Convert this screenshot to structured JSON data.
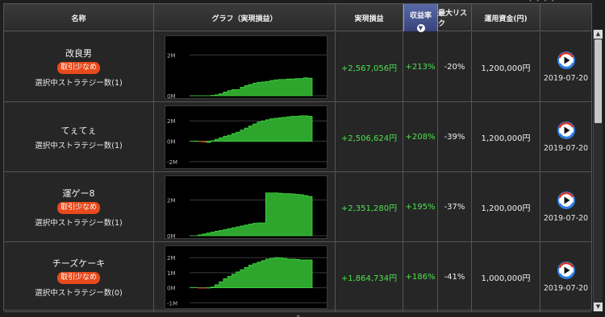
{
  "header": {
    "name": "名称",
    "graph": "グラフ（実現損益）",
    "profit": "実現損益",
    "return_rate": "収益率",
    "max_risk": "最大リスク",
    "capital": "運用資金(円)",
    "sort_icon": "chevron-down-icon"
  },
  "top_right_text": "・ ・ ・ ・",
  "bottom_indicator": "⌄",
  "colors": {
    "profit_green": "#4ee24e",
    "chart_green": "#2ea62e",
    "loss_red": "#e02020",
    "badge_orange": "#e84a1c",
    "header_sort_blue": "#4a5690"
  },
  "rows": [
    {
      "name": "改良男",
      "badge": "取引少なめ",
      "strategy_count": "選択中ストラテジー数(1)",
      "profit": "+2,567,056円",
      "return_rate": "+213%",
      "max_risk": "-20%",
      "capital": "1,200,000円",
      "date": "2019-07-20",
      "graph_labels": [
        "2M",
        "0M"
      ],
      "graph_series": [
        0,
        0,
        0,
        0,
        0,
        0.02,
        0.05,
        0.1,
        0.18,
        0.25,
        0.3,
        0.3,
        0.42,
        0.5,
        0.55,
        0.62,
        0.66,
        0.68,
        0.7,
        0.75,
        0.78,
        0.8,
        0.8,
        0.82,
        0.82,
        0.84,
        0.84,
        0.88,
        0.86,
        0.86
      ],
      "graph_range": [
        0,
        2.8
      ]
    },
    {
      "name": "てぇてぇ",
      "badge": "",
      "strategy_count": "選択中ストラテジー数(1)",
      "profit": "+2,506,624円",
      "return_rate": "+208%",
      "max_risk": "-39%",
      "capital": "1,200,000円",
      "date": "2019-07-20",
      "graph_labels": [
        "2M",
        "0M",
        "-2M"
      ],
      "graph_series": [
        0,
        0.02,
        0,
        -0.05,
        -0.12,
        0.05,
        0.2,
        0.35,
        0.5,
        0.6,
        0.75,
        0.9,
        1.1,
        1.3,
        1.5,
        1.7,
        1.9,
        2.0,
        2.1,
        2.2,
        2.25,
        2.3,
        2.35,
        2.4,
        2.45,
        2.45,
        2.5,
        2.5,
        2.45,
        2.35
      ],
      "graph_range": [
        -2.4,
        3.2
      ]
    },
    {
      "name": "運ゲー8",
      "badge": "取引少なめ",
      "strategy_count": "選択中ストラテジー数(1)",
      "profit": "+2,351,280円",
      "return_rate": "+195%",
      "max_risk": "-37%",
      "capital": "1,200,000円",
      "date": "2019-07-20",
      "graph_labels": [
        "2M",
        "0M"
      ],
      "graph_series": [
        0,
        0,
        0.05,
        0.1,
        0.15,
        0.2,
        0.25,
        0.3,
        0.35,
        0.4,
        0.45,
        0.5,
        0.55,
        0.6,
        0.65,
        0.7,
        0.72,
        0.72,
        2.4,
        2.4,
        2.4,
        2.38,
        2.36,
        2.36,
        2.34,
        2.32,
        2.3,
        2.25,
        2.2,
        2.15
      ],
      "graph_range": [
        0,
        3.2
      ]
    },
    {
      "name": "チーズケーキ",
      "badge": "取引少なめ",
      "strategy_count": "選択中ストラテジー数(0)",
      "profit": "+1,864,734円",
      "return_rate": "+186%",
      "max_risk": "-41%",
      "capital": "1,000,000円",
      "date": "2019-07-20",
      "graph_labels": [
        "2M",
        "1M",
        "0M",
        "-1M"
      ],
      "graph_series": [
        0,
        0,
        0,
        -0.02,
        -0.02,
        0.05,
        0.2,
        0.4,
        0.6,
        0.75,
        0.9,
        1.05,
        1.2,
        1.35,
        1.5,
        1.6,
        1.7,
        1.8,
        1.9,
        1.95,
        2.0,
        1.98,
        1.95,
        1.9,
        1.9,
        1.88,
        1.85,
        1.85,
        1.85,
        1.85
      ],
      "graph_range": [
        -1.2,
        2.6
      ]
    }
  ]
}
